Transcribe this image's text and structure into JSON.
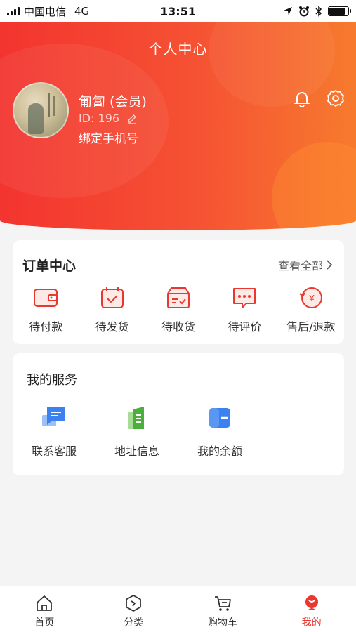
{
  "status_bar": {
    "carrier": "中国电信",
    "network": "4G",
    "time": "13:51"
  },
  "header": {
    "title": "个人中心",
    "user_name": "匍匐 (会员)",
    "user_id_label": "ID: 196",
    "bind_phone": "绑定手机号"
  },
  "order_center": {
    "title": "订单中心",
    "view_all": "查看全部",
    "items": [
      {
        "label": "待付款",
        "icon": "wallet-icon"
      },
      {
        "label": "待发货",
        "icon": "calendar-check-icon"
      },
      {
        "label": "待收货",
        "icon": "package-icon"
      },
      {
        "label": "待评价",
        "icon": "comment-icon"
      },
      {
        "label": "售后/退款",
        "icon": "refund-icon"
      }
    ]
  },
  "services": {
    "title": "我的服务",
    "items": [
      {
        "label": "联系客服",
        "icon": "chat-icon"
      },
      {
        "label": "地址信息",
        "icon": "address-icon"
      },
      {
        "label": "我的余额",
        "icon": "balance-icon"
      }
    ]
  },
  "tab_bar": {
    "items": [
      {
        "label": "首页",
        "icon": "home-icon"
      },
      {
        "label": "分类",
        "icon": "category-icon"
      },
      {
        "label": "购物车",
        "icon": "cart-icon"
      },
      {
        "label": "我的",
        "icon": "profile-icon",
        "active": true
      }
    ]
  },
  "colors": {
    "accent": "#e8382f",
    "header_start": "#f3342f",
    "header_end": "#f77a2e"
  }
}
